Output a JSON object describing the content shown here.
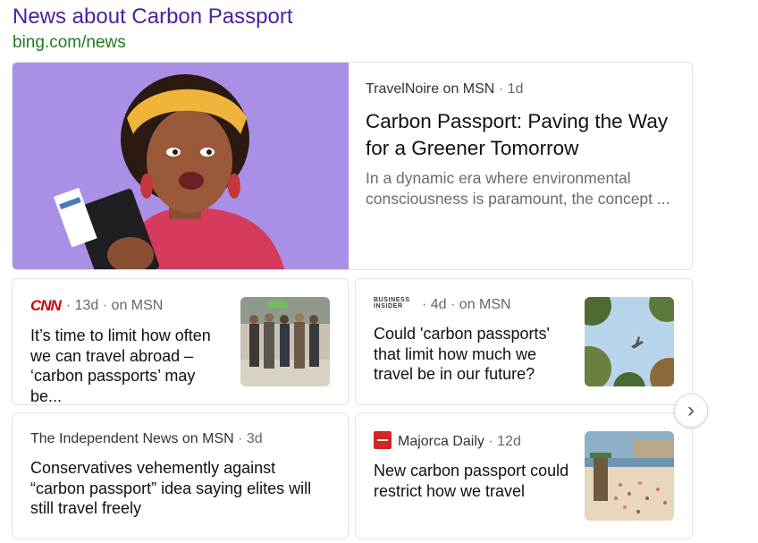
{
  "header": {
    "title": "News about Carbon Passport",
    "source": "bing.com/news"
  },
  "hero": {
    "publisher": "TravelNoire on MSN",
    "age": "1d",
    "headline": "Carbon Passport: Paving the Way for a Greener Tomorrow",
    "snippet": "In a dynamic era where environmental consciousness is paramount, the concept ..."
  },
  "cards": [
    {
      "logo": "CNN",
      "age": "13d",
      "via": "on MSN",
      "headline": "It’s time to limit how often we can travel abroad – ‘carbon passports’ may be..."
    },
    {
      "logo": "BUSINESS INSIDER",
      "age": "4d",
      "via": "on MSN",
      "headline": "Could 'carbon passports' that limit how much we travel be in our future?"
    },
    {
      "publisher": "The Independent News on MSN",
      "age": "3d",
      "headline": "Conservatives vehemently against “carbon passport” idea saying elites will still travel freely"
    },
    {
      "publisher": "Majorca Daily",
      "age": "12d",
      "headline": "New carbon passport could restrict how we travel"
    }
  ],
  "icons": {
    "next": "chevron-right-icon"
  },
  "colors": {
    "title": "#4b1fa3",
    "source_url": "#1f7a1f",
    "hero_bg": "#a990e6",
    "cnn_red": "#cc0000",
    "majorca_red": "#d42525"
  }
}
